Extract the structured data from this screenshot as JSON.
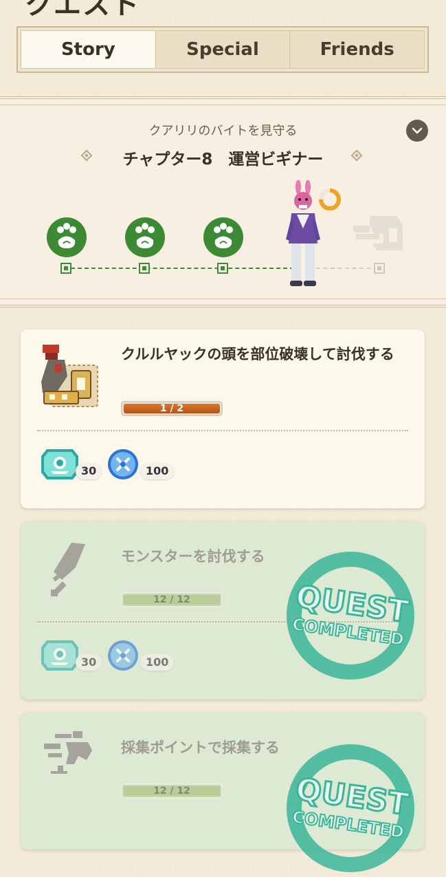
{
  "header": {
    "title": "クエスト"
  },
  "tabs": [
    {
      "label": "Story",
      "active": true
    },
    {
      "label": "Special",
      "active": false
    },
    {
      "label": "Friends",
      "active": false
    }
  ],
  "chapter": {
    "subtitle": "クアリリのバイトを見守る",
    "title": "チャプター8　運営ビギナー",
    "completed_steps": 3,
    "total_steps": 5
  },
  "quests": [
    {
      "title": "クルルヤックの頭を部位破壊して討伐する",
      "progress_text": "1 / 2",
      "progress": 0.5,
      "status": "active",
      "icon": "monster-icon",
      "rewards": [
        {
          "icon": "gem-reward-icon",
          "count": "30"
        },
        {
          "icon": "blue-orb-reward-icon",
          "count": "100"
        }
      ]
    },
    {
      "title": "モンスターを討伐する",
      "progress_text": "12 / 12",
      "progress": 1.0,
      "status": "completed",
      "icon": "sword-icon",
      "stamp_text_1": "QUEST",
      "stamp_text_2": "COMPLETED",
      "rewards": [
        {
          "icon": "gem-reward-icon",
          "count": "30"
        },
        {
          "icon": "blue-orb-reward-icon",
          "count": "100"
        }
      ]
    },
    {
      "title": "採集ポイントで採集する",
      "progress_text": "12 / 12",
      "progress": 1.0,
      "status": "completed",
      "icon": "gather-icon",
      "stamp_text_1": "QUEST",
      "stamp_text_2": "COMPLETED",
      "rewards": []
    }
  ],
  "colors": {
    "accent_green": "#3c8a33",
    "progress_orange": "#c8651f",
    "stamp_teal": "#3bb59a"
  }
}
